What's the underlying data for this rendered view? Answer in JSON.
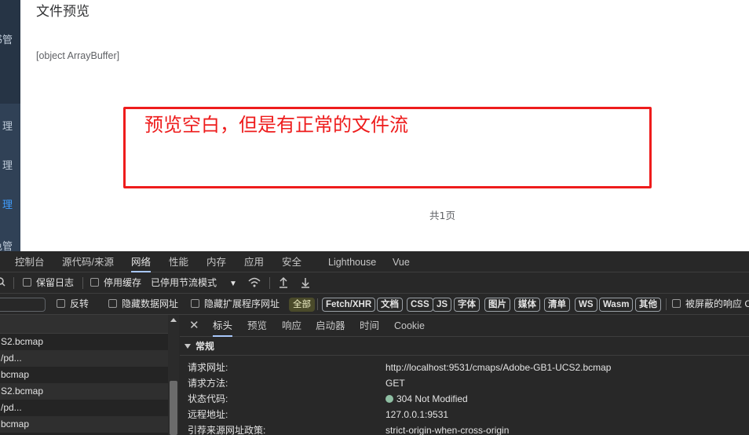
{
  "sidebar": {
    "items": [
      "书管",
      "理",
      "理",
      "理",
      "色管"
    ],
    "active_index": 3
  },
  "content": {
    "title": "文件预览",
    "object_text": "[object ArrayBuffer]",
    "annotation": "预览空白，但是有正常的文件流",
    "page_count": "共1页"
  },
  "devtools": {
    "tabs": [
      "控制台",
      "源代码/来源",
      "网络",
      "性能",
      "内存",
      "应用",
      "安全",
      "Lighthouse",
      "Vue"
    ],
    "active_tab": "网络",
    "toolbar1": {
      "preserve_log": "保留日志",
      "disable_cache": "停用缓存",
      "throttle": "已停用节流模式"
    },
    "toolbar2": {
      "invert": "反转",
      "hide_data_urls": "隐藏数据网址",
      "hide_ext_urls": "隐藏扩展程序网址",
      "filters": [
        "全部",
        "Fetch/XHR",
        "文档",
        "CSS",
        "JS",
        "字体",
        "图片",
        "媒体",
        "清单",
        "WS",
        "Wasm",
        "其他"
      ],
      "blocked": "被屏蔽的响应 C"
    },
    "requests": [
      "S2.bcmap",
      "/pd...",
      "bcmap",
      "S2.bcmap",
      "/pd...",
      "bcmap"
    ],
    "detail_tabs": [
      "标头",
      "预览",
      "响应",
      "启动器",
      "时间",
      "Cookie"
    ],
    "detail_active": "标头",
    "general": {
      "title": "常规",
      "rows": [
        {
          "key": "请求网址:",
          "value": "http://localhost:9531/cmaps/Adobe-GB1-UCS2.bcmap"
        },
        {
          "key": "请求方法:",
          "value": "GET"
        },
        {
          "key": "状态代码:",
          "value": "304 Not Modified"
        },
        {
          "key": "远程地址:",
          "value": "127.0.0.1:9531"
        },
        {
          "key": "引荐来源网址政策:",
          "value": "strict-origin-when-cross-origin"
        }
      ]
    },
    "colors": {
      "accent": "#a8c7fa",
      "status_ok": "#8fbfa3",
      "annotation": "#ee1c1c"
    }
  }
}
